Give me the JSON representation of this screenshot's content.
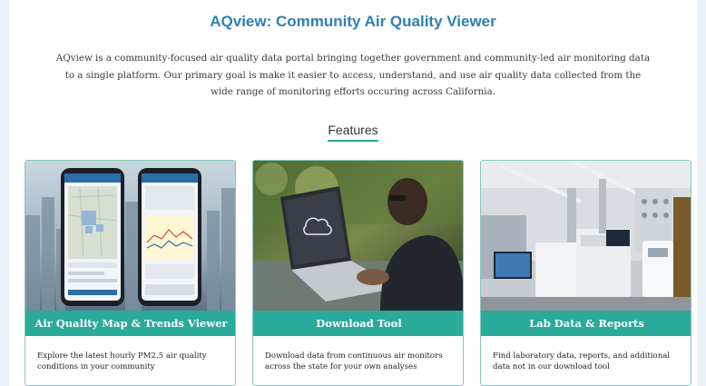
{
  "header": {
    "title": "AQview: Community Air Quality Viewer",
    "intro": "AQview is a community-focused air quality data portal bringing together government and community-led air monitoring data to a single platform. Our primary goal is make it easier to access, understand, and use air quality data collected from the wide range of monitoring efforts occuring across California."
  },
  "features": {
    "heading": "Features",
    "cards": [
      {
        "title": "Air Quality Map & Trends Viewer",
        "description": "Explore the latest hourly PM2.5 air quality conditions in your community",
        "image_icon": "phones-screenshot-image"
      },
      {
        "title": "Download Tool",
        "description": "Download data from continuous air monitors across the state for your own analyses",
        "image_icon": "laptop-download-image"
      },
      {
        "title": "Lab Data & Reports",
        "description": "Find laboratory data, reports, and additional data not in our download tool",
        "image_icon": "laboratory-image"
      }
    ]
  },
  "colors": {
    "title_blue": "#2f7fb3",
    "accent_teal": "#2aaa9a",
    "card_border": "#86c9be"
  }
}
